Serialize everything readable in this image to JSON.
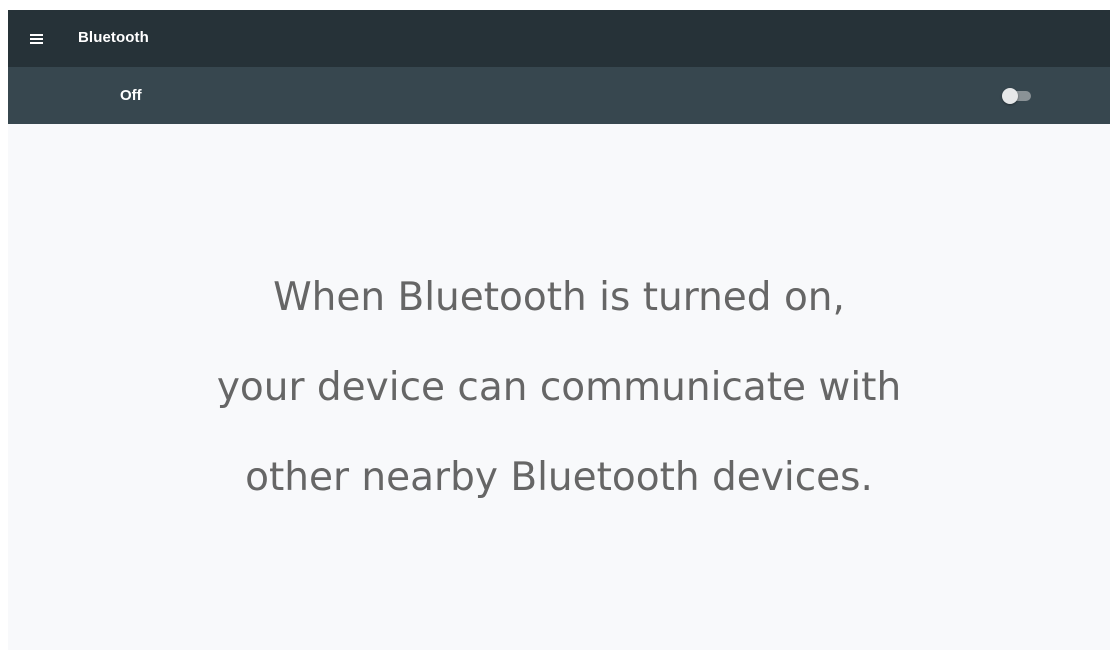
{
  "header": {
    "menu_icon": "hamburger-menu-icon",
    "title": "Bluetooth"
  },
  "switch_bar": {
    "state_label": "Off",
    "toggle_on": false
  },
  "message": {
    "line1": "When Bluetooth is turned on,",
    "line2": "your device can communicate with",
    "line3": "other nearby Bluetooth devices."
  },
  "colors": {
    "topbar": "#263238",
    "switchbar": "#37474f",
    "background": "#f8f9fb",
    "message_text": "#666666"
  }
}
